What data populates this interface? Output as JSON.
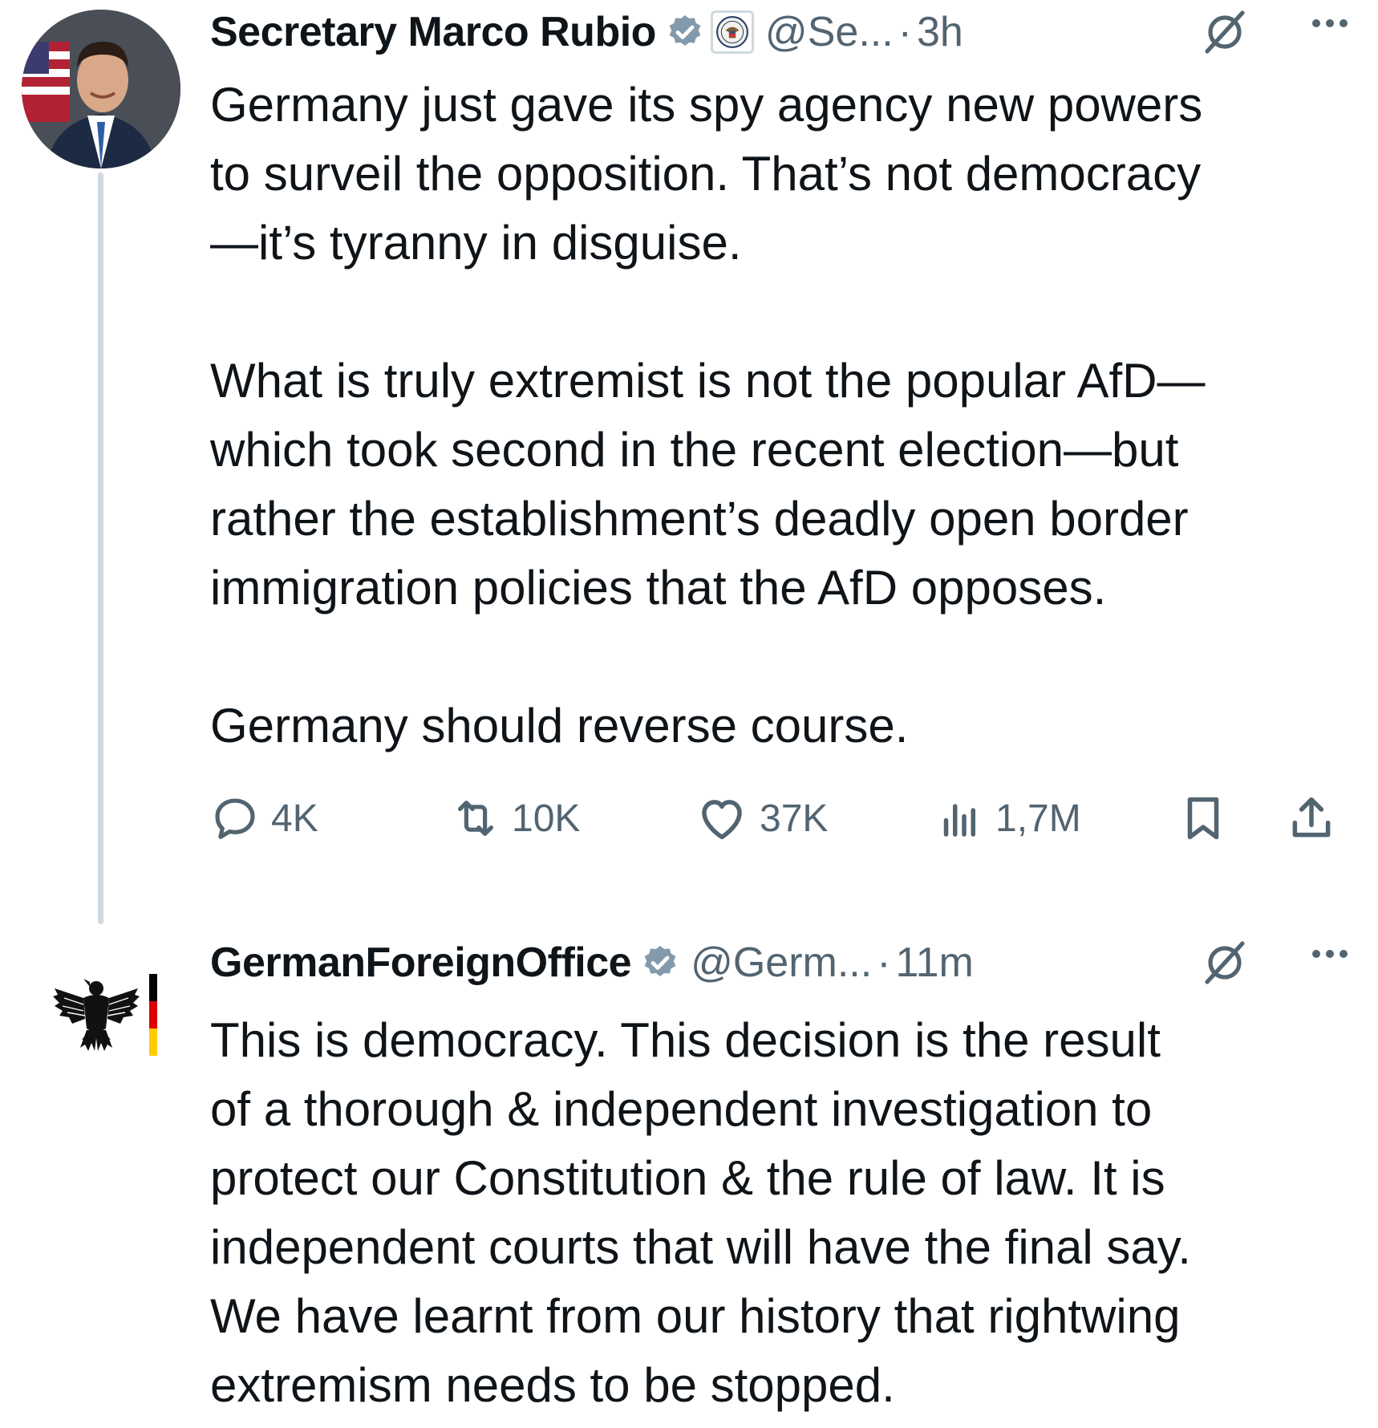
{
  "tweets": [
    {
      "name": "Secretary Marco Rubio",
      "handle": "@Se...",
      "separator": "·",
      "time": "3h",
      "paragraphs": [
        [
          "Germany just gave its spy agency new powers",
          "to surveil the opposition.  That’s not democracy",
          "—it’s tyranny in disguise."
        ],
        [
          "What is truly extremist is not the popular AfD—",
          "which took second in the recent election—but",
          "rather the establishment’s deadly open border",
          "immigration policies that the AfD opposes."
        ],
        [
          "Germany should reverse course."
        ]
      ],
      "stats": {
        "replies": "4K",
        "reposts": "10K",
        "likes": "37K",
        "views": "1,7M"
      }
    },
    {
      "name": "GermanForeignOffice",
      "handle": "@Germ...",
      "separator": "·",
      "time": "11m",
      "paragraphs": [
        [
          "This is democracy. This decision is the result",
          "of a thorough & independent investigation to",
          "protect our Constitution & the rule of law. It is",
          "independent courts that will have the final say.",
          "We have learnt from our history that rightwing",
          "extremism needs to be stopped."
        ]
      ]
    }
  ],
  "colors": {
    "text": "#0f1419",
    "secondary": "#536471",
    "verified_badge": "#829aab",
    "thread_line": "#cfd9de"
  },
  "icons": [
    "verified-badge-icon",
    "state-department-seal-icon",
    "grok-icon",
    "more-icon",
    "reply-icon",
    "repost-icon",
    "like-icon",
    "views-icon",
    "bookmark-icon",
    "share-icon",
    "german-eagle-icon"
  ]
}
